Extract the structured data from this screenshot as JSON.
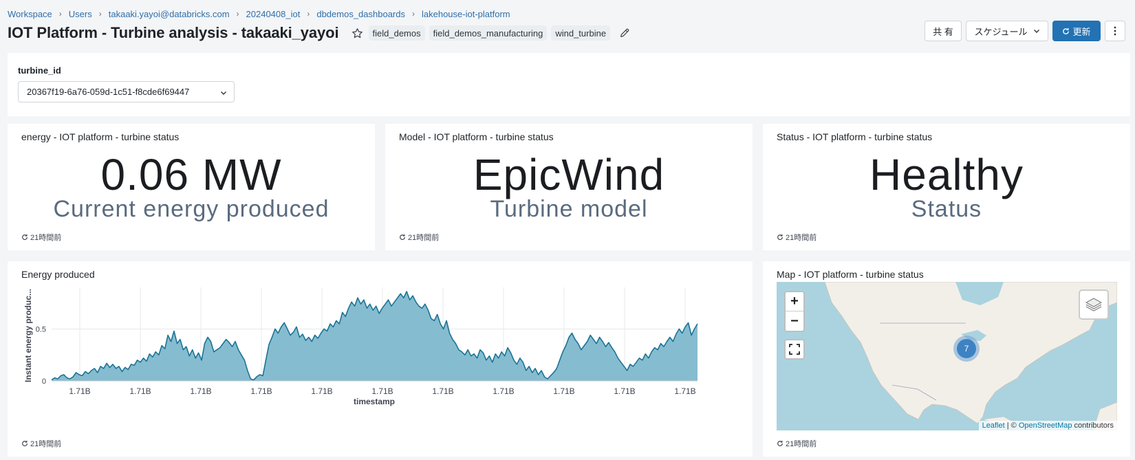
{
  "breadcrumb": [
    "Workspace",
    "Users",
    "takaaki.yayoi@databricks.com",
    "20240408_iot",
    "dbdemos_dashboards",
    "lakehouse-iot-platform"
  ],
  "title": "IOT Platform - Turbine analysis - takaaki_yayoi",
  "tags": [
    "field_demos",
    "field_demos_manufacturing",
    "wind_turbine"
  ],
  "actions": {
    "share": "共 有",
    "schedule": "スケジュール",
    "refresh": "更新"
  },
  "filter": {
    "label": "turbine_id",
    "value": "20367f19-6a76-059d-1c51-f8cde6f69447"
  },
  "counters": [
    {
      "title": "energy - IOT platform - turbine status",
      "value": "0.06 MW",
      "caption": "Current energy produced",
      "refreshed": "21時間前"
    },
    {
      "title": "Model - IOT platform - turbine status",
      "value": "EpicWind",
      "caption": "Turbine model",
      "refreshed": "21時間前"
    },
    {
      "title": "Status - IOT platform - turbine status",
      "value": "Healthy",
      "caption": "Status",
      "refreshed": "21時間前"
    }
  ],
  "energy_chart": {
    "title": "Energy produced",
    "refreshed": "21時間前"
  },
  "map_card": {
    "title": "Map - IOT platform - turbine status",
    "cluster_count": "7",
    "attribution": {
      "leaflet": "Leaflet",
      "sep": " | © ",
      "osm": "OpenStreetMap",
      "suffix": " contributors"
    },
    "refreshed": "21時間前"
  },
  "colors": {
    "accent": "#2272b4",
    "series_line": "#1a7396",
    "series_fill": "#7fb8cc",
    "map_water": "#aad3df",
    "map_land": "#f2efe9"
  },
  "chart_data": {
    "type": "area",
    "xlabel": "timestamp",
    "ylabel": "Instant energy produc...",
    "x_tick_labels": [
      "1.71B",
      "1.71B",
      "1.71B",
      "1.71B",
      "1.71B",
      "1.71B",
      "1.71B",
      "1.71B",
      "1.71B",
      "1.71B",
      "1.71B"
    ],
    "y_tick_labels": [
      "0",
      "0.5"
    ],
    "ylim": [
      0,
      0.9
    ],
    "grid": true,
    "series": [
      {
        "values": [
          0.01,
          0.03,
          0.02,
          0.05,
          0.06,
          0.03,
          0.02,
          0.04,
          0.08,
          0.06,
          0.05,
          0.09,
          0.07,
          0.1,
          0.12,
          0.08,
          0.14,
          0.12,
          0.17,
          0.13,
          0.16,
          0.12,
          0.14,
          0.09,
          0.13,
          0.11,
          0.16,
          0.15,
          0.2,
          0.18,
          0.22,
          0.19,
          0.26,
          0.23,
          0.28,
          0.25,
          0.34,
          0.31,
          0.44,
          0.38,
          0.48,
          0.36,
          0.4,
          0.3,
          0.33,
          0.24,
          0.3,
          0.22,
          0.27,
          0.2,
          0.36,
          0.42,
          0.38,
          0.28,
          0.3,
          0.32,
          0.36,
          0.4,
          0.37,
          0.33,
          0.38,
          0.3,
          0.25,
          0.2,
          0.1,
          0.02,
          0.01,
          0.04,
          0.06,
          0.05,
          0.2,
          0.35,
          0.42,
          0.5,
          0.46,
          0.52,
          0.56,
          0.5,
          0.44,
          0.47,
          0.52,
          0.42,
          0.45,
          0.39,
          0.42,
          0.38,
          0.44,
          0.41,
          0.46,
          0.5,
          0.48,
          0.55,
          0.52,
          0.58,
          0.55,
          0.66,
          0.62,
          0.7,
          0.76,
          0.72,
          0.8,
          0.74,
          0.78,
          0.7,
          0.74,
          0.68,
          0.72,
          0.65,
          0.7,
          0.74,
          0.78,
          0.72,
          0.76,
          0.8,
          0.84,
          0.8,
          0.86,
          0.78,
          0.82,
          0.76,
          0.72,
          0.7,
          0.74,
          0.68,
          0.6,
          0.58,
          0.64,
          0.55,
          0.5,
          0.58,
          0.46,
          0.4,
          0.36,
          0.3,
          0.28,
          0.25,
          0.3,
          0.24,
          0.26,
          0.22,
          0.3,
          0.27,
          0.2,
          0.24,
          0.18,
          0.26,
          0.22,
          0.28,
          0.24,
          0.32,
          0.27,
          0.2,
          0.16,
          0.22,
          0.18,
          0.1,
          0.14,
          0.08,
          0.12,
          0.06,
          0.1,
          0.04,
          0.02,
          0.05,
          0.08,
          0.12,
          0.2,
          0.28,
          0.34,
          0.42,
          0.46,
          0.4,
          0.36,
          0.3,
          0.34,
          0.38,
          0.44,
          0.4,
          0.36,
          0.42,
          0.38,
          0.33,
          0.37,
          0.32,
          0.28,
          0.22,
          0.18,
          0.14,
          0.1,
          0.16,
          0.14,
          0.18,
          0.22,
          0.2,
          0.26,
          0.22,
          0.28,
          0.32,
          0.3,
          0.36,
          0.33,
          0.38,
          0.42,
          0.38,
          0.45,
          0.5,
          0.46,
          0.52,
          0.56,
          0.44,
          0.5,
          0.55
        ]
      }
    ]
  }
}
